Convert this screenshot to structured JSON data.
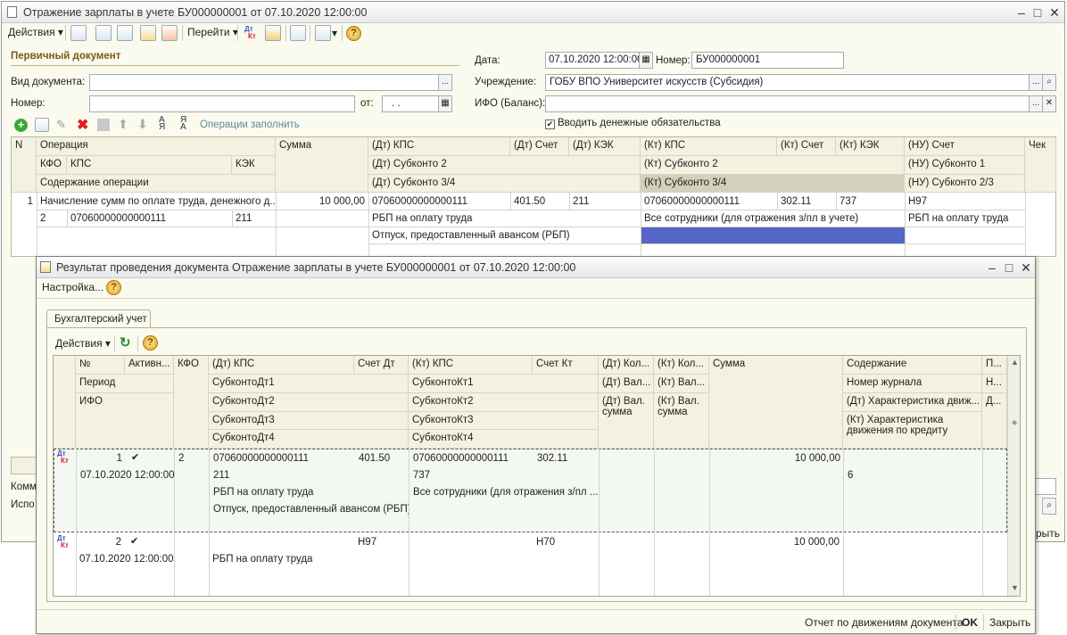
{
  "doc": {
    "title": "Отражение зарплаты в учете БУ000000001 от 07.10.2020 12:00:00",
    "menu": {
      "actions": "Действия",
      "goto": "Перейти"
    },
    "section": "Первичный документ",
    "vid_label": "Вид документа:",
    "nomer_label": "Номер:",
    "ot_label": "от:",
    "date_ph": ". .",
    "date_label": "Дата:",
    "date_value": "07.10.2020 12:00:00",
    "num_label": "Номер:",
    "num_value": "БУ000000001",
    "uchr_label": "Учреждение:",
    "uchr_value": "ГОБУ ВПО Университет искусств (Субсидия)",
    "ifo_label": "ИФО (Баланс):",
    "checkbox_label": "Вводить денежные обязательства",
    "fill_ops": "Операции заполнить",
    "headers": {
      "n": "N",
      "op": "Операция",
      "kfo": "КФО",
      "kps": "КПС",
      "kek": "КЭК",
      "content": "Содержание операции",
      "sum": "Сумма",
      "dt_kps": "(Дт) КПС",
      "dt_sch": "(Дт) Счет",
      "dt_kek": "(Дт) КЭК",
      "dt_sub2": "(Дт) Субконто 2",
      "dt_sub34": "(Дт) Субконто 3/4",
      "kt_kps": "(Кт) КПС",
      "kt_sch": "(Кт) Счет",
      "kt_kek": "(Кт) КЭК",
      "kt_sub2": "(Кт) Субконто 2",
      "kt_sub34": "(Кт) Субконто 3/4",
      "nu_sch": "(НУ) Счет",
      "nu_sub1": "(НУ) Субконто 1",
      "nu_sub23": "(НУ) Субконто 2/3",
      "chek": "Чек"
    },
    "row": {
      "n": "1",
      "op": "Начисление сумм по оплате труда, денежного д...",
      "kfo": "2",
      "kps": "07060000000000111",
      "kek": "211",
      "sum": "10 000,00",
      "dt_kps": "07060000000000111",
      "dt_sch": "401.50",
      "dt_kek": "211",
      "dt_sub2": "РБП на оплату труда",
      "dt_sub3": "Отпуск, предоставленный авансом (РБП)",
      "kt_kps": "07060000000000111",
      "kt_sch": "302.11",
      "kt_kek": "737",
      "kt_sub2": "Все сотрудники (для отражения з/пл в учете)",
      "nu_sch": "Н97",
      "nu_sub1": "РБП на оплату труда"
    },
    "bottom": {
      "komm": "Комм",
      "ispo": "Испо",
      "close_part": "рыть"
    }
  },
  "dialog": {
    "title": "Результат проведения документа Отражение зарплаты в учете БУ000000001 от 07.10.2020 12:00:00",
    "settings": "Настройка...",
    "tab": "Бухгалтерский учет",
    "actions": "Действия",
    "headers": {
      "num": "№",
      "active": "Активн...",
      "period": "Период",
      "ifo": "ИФО",
      "kfo": "КФО",
      "dt_kps": "(Дт) КПС",
      "sch_dt": "Счет Дт",
      "sub_dt1": "СубконтоДт1",
      "sub_dt2": "СубконтоДт2",
      "sub_dt3": "СубконтоДт3",
      "sub_dt4": "СубконтоДт4",
      "kt_kps": "(Кт) КПС",
      "sch_kt": "Счет Кт",
      "sub_kt1": "СубконтоКт1",
      "sub_kt2": "СубконтоКт2",
      "sub_kt3": "СубконтоКт3",
      "sub_kt4": "СубконтоКт4",
      "dt_kol": "(Дт) Кол...",
      "dt_val": "(Дт) Вал...",
      "dt_val_sum": "(Дт) Вал. сумма",
      "kt_kol": "(Кт) Кол...",
      "kt_val": "(Кт) Вал...",
      "kt_val_sum": "(Кт) Вал. сумма",
      "summa": "Сумма",
      "content": "Содержание",
      "journal": "Номер журнала",
      "dt_char": "(Дт) Характеристика движ...",
      "kt_char": "(Кт) Характеристика движения по кредиту",
      "p": "П...",
      "n": "Н...",
      "d": "Д..."
    },
    "rows": [
      {
        "num": "1",
        "period": "07.10.2020 12:00:00",
        "kfo": "2",
        "dt_kps": "07060000000000111",
        "dt_kek": "211",
        "dt_sub1": "РБП на оплату труда",
        "dt_sub2": "Отпуск, предоставленный авансом (РБП)",
        "sch_dt": "401.50",
        "kt_kps": "07060000000000111",
        "kt_kek": "737",
        "kt_sub1": "Все сотрудники (для отражения з/пл ...",
        "sch_kt": "302.11",
        "sum": "10 000,00",
        "journal": "6"
      },
      {
        "num": "2",
        "period": "07.10.2020 12:00:00",
        "dt_sub1": "РБП на оплату труда",
        "sch_dt": "Н97",
        "sch_kt": "Н70",
        "sum": "10 000,00"
      }
    ],
    "footer": {
      "report": "Отчет по движениям документа",
      "ok": "OK",
      "close": "Закрыть"
    }
  }
}
